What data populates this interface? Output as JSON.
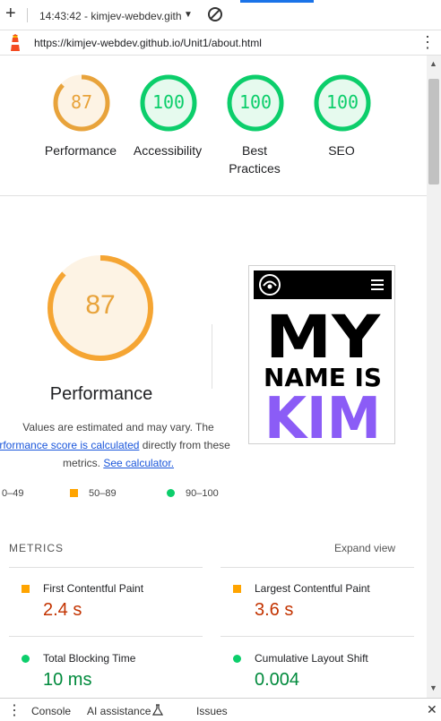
{
  "toolbar": {
    "new_tab_icon": "plus-icon",
    "tab_selector": "14:43:42 - kimjev-webdev.gith",
    "clear_icon": "block-icon"
  },
  "address": {
    "url": "https://kimjev-webdev.github.io/Unit1/about.html",
    "menu_icon": "more-vert-icon"
  },
  "summary": [
    {
      "score": "87",
      "label": "Performance",
      "color": "#e8a33b",
      "fill": "#fdf3e4",
      "fraction": 0.87
    },
    {
      "score": "100",
      "label": "Accessibility",
      "color": "#0cce6b",
      "fill": "#e6faee",
      "fraction": 1.0
    },
    {
      "score": "100",
      "label": "Best Practices",
      "color": "#0cce6b",
      "fill": "#e6faee",
      "fraction": 1.0
    },
    {
      "score": "100",
      "label": "SEO",
      "color": "#0cce6b",
      "fill": "#e6faee",
      "fraction": 1.0
    }
  ],
  "performance": {
    "score": "87",
    "fraction": 0.87,
    "title": "Performance",
    "desc_line1": "Values are estimated and may vary. The",
    "desc_link1": "performance score is calculated",
    "desc_after_link": " directly from these",
    "desc_line3_prefix": "metrics. ",
    "desc_link2": "See calculator."
  },
  "legend": [
    {
      "label": "0–49",
      "color": "#ff4e42",
      "shape": "triangle"
    },
    {
      "label": "50–89",
      "color": "#ffa400",
      "shape": "square"
    },
    {
      "label": "90–100",
      "color": "#0cce6b",
      "shape": "circle"
    }
  ],
  "screenshot": {
    "line1": "MY",
    "line2": "NAME IS",
    "line3": "KIM",
    "accent": "#8b5cf6"
  },
  "metrics": {
    "heading": "METRICS",
    "expand_label": "Expand view",
    "items": [
      {
        "name": "First Contentful Paint",
        "value": "2.4 s",
        "color": "#c33300",
        "marker": "square",
        "marker_color": "#ffa400"
      },
      {
        "name": "Largest Contentful Paint",
        "value": "3.6 s",
        "color": "#c33300",
        "marker": "square",
        "marker_color": "#ffa400"
      },
      {
        "name": "Total Blocking Time",
        "value": "10 ms",
        "color": "#008a3c",
        "marker": "circle",
        "marker_color": "#0cce6b"
      },
      {
        "name": "Cumulative Layout Shift",
        "value": "0.004",
        "color": "#008a3c",
        "marker": "circle",
        "marker_color": "#0cce6b"
      }
    ]
  },
  "drawer": {
    "menu_icon": "more-vert-icon",
    "tabs": [
      "Console",
      "AI assistance",
      "Issues"
    ],
    "flask_icon": "flask-icon",
    "close_icon": "close-icon"
  }
}
